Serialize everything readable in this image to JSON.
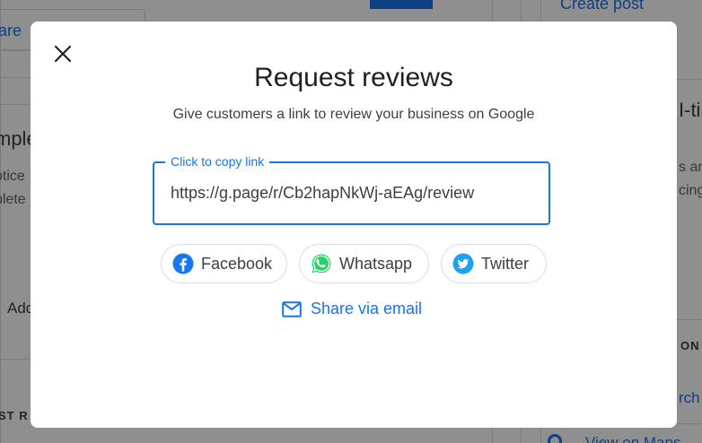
{
  "background": {
    "top_left_text": "are",
    "top_right_link": "Create post",
    "left_heading": "mple",
    "left_line_1": "otice",
    "left_line_2": "plete",
    "left_add": "Add",
    "left_bottom": "ST R",
    "right_heading": "I-ti",
    "right_line_1": "s an",
    "right_line_2": "cing",
    "right_section": "ON",
    "right_search": "rch",
    "right_bottom": "View on Maps"
  },
  "dialog": {
    "title": "Request reviews",
    "subtitle": "Give customers a link to review your business on Google",
    "link_field": {
      "label": "Click to copy link",
      "value": "https://g.page/r/Cb2hapNkWj-aEAg/review"
    },
    "share_buttons": [
      {
        "label": "Facebook",
        "icon": "facebook-icon",
        "color": "#1877f2"
      },
      {
        "label": "Whatsapp",
        "icon": "whatsapp-icon",
        "color": "#25d366"
      },
      {
        "label": "Twitter",
        "icon": "twitter-icon",
        "color": "#1da1f2"
      }
    ],
    "email_link": {
      "label": "Share via email",
      "icon": "mail-icon"
    },
    "accent_color": "#1a73e8"
  }
}
